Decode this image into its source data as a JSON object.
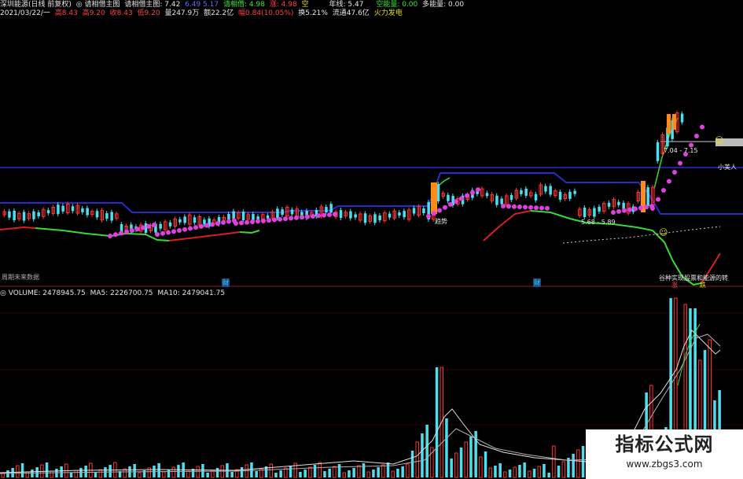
{
  "header1": {
    "stock": "深圳能源(日线 前复权)",
    "indicator_main": "◎ 请相借主图",
    "indicator_value_label": "请相借主图: 7.42",
    "blue_value": "6.49 5.17",
    "green_label": "请相借: 4.98",
    "red_label": "涨: 4.98",
    "yellow_mark": "空",
    "line_label": "年线: 5.47",
    "kong_label": "空能量: 0.00",
    "duo_label": "多能量: 0.00"
  },
  "header2": {
    "date": "2021/03/22/一",
    "open": "高8.43",
    "high": "高9.20",
    "high2": "收8.43",
    "low": "低9.20",
    "vol": "量247.9万",
    "amount": "额22.2亿",
    "change": "幅0.84(10.05%)",
    "turnover": "换5.21%",
    "float": "流通47.6亿",
    "tag": "火力发电"
  },
  "chart_labels": {
    "qushi": "趋势",
    "xiaomeiren": "小美人",
    "range1": "7.04 - 7.15",
    "range2": "5.68 - 5.89",
    "future": "周期未来数据",
    "bottom_note": "谷种实现股票和能源的转",
    "mark_cai1": "财",
    "mark_cai2": "财",
    "mark_zhang": "涨",
    "mark_die": "跌",
    "smile_top": "☺",
    "smile_mid": "☺"
  },
  "volume_header": {
    "title": "◎ VOLUME: 2478945.75",
    "ma5": "MA5: 2226700.75",
    "ma10": "MA10: 2479041.75"
  },
  "watermark": {
    "title": "指标公式网",
    "url": "www.zbgs3.com"
  },
  "colors": {
    "background": "#000000",
    "up": "#ff3333",
    "down": "#4ce0ee",
    "resistance": "#2a2ad0",
    "dots": "#e040e0",
    "support_green": "#38d838",
    "support_red": "#d82020",
    "divider": "#8a1a1a"
  }
}
